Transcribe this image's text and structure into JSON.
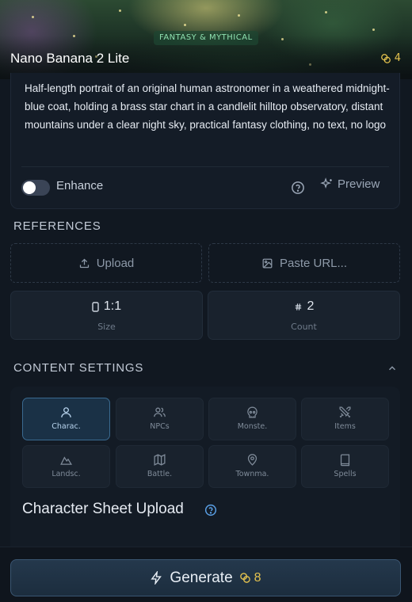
{
  "header": {
    "genre_badge": "FANTASY & MYTHICAL",
    "model_name": "Nano Banana 2 Lite",
    "model_cost": "4"
  },
  "prompt": {
    "text": "Half-length portrait of an original human astronomer in a weathered midnight-blue coat, holding a brass star chart in a candlelit hilltop observatory, distant mountains under a clear night sky, practical fantasy clothing, no text, no logo",
    "enhance_label": "Enhance",
    "enhance_on": false,
    "preview_label": "Preview"
  },
  "references": {
    "heading": "REFERENCES",
    "upload_label": "Upload",
    "paste_url_label": "Paste URL..."
  },
  "params": {
    "size_value": "1:1",
    "size_label": "Size",
    "count_value": "2",
    "count_label": "Count"
  },
  "content_settings": {
    "heading": "CONTENT SETTINGS",
    "categories": [
      {
        "label": "Charac.",
        "icon": "user-icon",
        "active": true
      },
      {
        "label": "NPCs",
        "icon": "users-icon",
        "active": false
      },
      {
        "label": "Monste.",
        "icon": "skull-icon",
        "active": false
      },
      {
        "label": "Items",
        "icon": "swords-icon",
        "active": false
      },
      {
        "label": "Landsc.",
        "icon": "mountain-icon",
        "active": false
      },
      {
        "label": "Battle.",
        "icon": "map-icon",
        "active": false
      },
      {
        "label": "Townma.",
        "icon": "map-pin-icon",
        "active": false
      },
      {
        "label": "Spells",
        "icon": "book-icon",
        "active": false
      }
    ],
    "sheet_title": "Character Sheet Upload"
  },
  "footer": {
    "generate_label": "Generate",
    "generate_cost": "8"
  },
  "colors": {
    "accent": "#3a6a90",
    "coin": "#e4c24e",
    "badge_text": "#8fe0b0"
  }
}
